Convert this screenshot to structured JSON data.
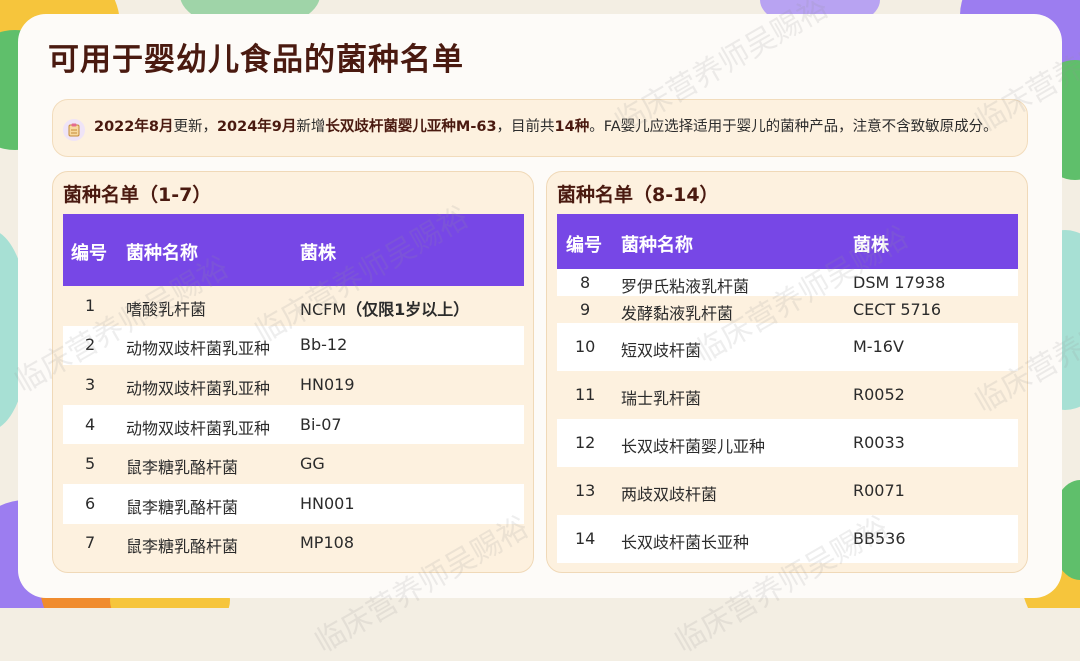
{
  "title": "可用于婴幼儿食品的菌种名单",
  "note": {
    "icon": "clipboard-icon",
    "t1": "2022年8月",
    "t2": "更新，",
    "t3": "2024年9月",
    "t4": "新增",
    "t5": "长双歧杆菌婴儿亚种M-63",
    "t6": "，目前共",
    "t7": "14种",
    "t8": "。FA婴儿应选择适用于婴儿的菌种产品，注意不含致敏原成分。"
  },
  "left": {
    "title": "菌种名单（1-7）",
    "headers": [
      "编号",
      "菌种名称",
      "菌株"
    ],
    "rows": [
      {
        "no": "1",
        "name": "嗜酸乳杆菌",
        "strain": "NCFM",
        "strain_note": "（仅限1岁以上）"
      },
      {
        "no": "2",
        "name": "动物双歧杆菌乳亚种",
        "strain": "Bb-12",
        "strain_note": ""
      },
      {
        "no": "3",
        "name": "动物双歧杆菌乳亚种",
        "strain": "HN019",
        "strain_note": ""
      },
      {
        "no": "4",
        "name": "动物双歧杆菌乳亚种",
        "strain": "Bi-07",
        "strain_note": ""
      },
      {
        "no": "5",
        "name": "鼠李糖乳酪杆菌",
        "strain": "GG",
        "strain_note": ""
      },
      {
        "no": "6",
        "name": "鼠李糖乳酪杆菌",
        "strain": "HN001",
        "strain_note": ""
      },
      {
        "no": "7",
        "name": "鼠李糖乳酪杆菌",
        "strain": "MP108",
        "strain_note": ""
      }
    ]
  },
  "right": {
    "title": "菌种名单（8-14）",
    "headers": [
      "编号",
      "菌种名称",
      "菌株"
    ],
    "rows": [
      {
        "no": "8",
        "name": "罗伊氏粘液乳杆菌",
        "strain": "DSM 17938"
      },
      {
        "no": "9",
        "name": "发酵黏液乳杆菌",
        "strain": "CECT 5716"
      },
      {
        "no": "10",
        "name": "短双歧杆菌",
        "strain": "M-16V"
      },
      {
        "no": "11",
        "name": "瑞士乳杆菌",
        "strain": "R0052"
      },
      {
        "no": "12",
        "name": "长双歧杆菌婴儿亚种",
        "strain": "R0033"
      },
      {
        "no": "13",
        "name": "两歧双歧杆菌",
        "strain": "R0071"
      },
      {
        "no": "14",
        "name": "长双歧杆菌长亚种",
        "strain": "BB536"
      }
    ]
  },
  "watermark": "临床营养师吴赐裕",
  "colors": {
    "header": "#7747e6",
    "title": "#4a1a10",
    "panel": "#fdf1df"
  }
}
